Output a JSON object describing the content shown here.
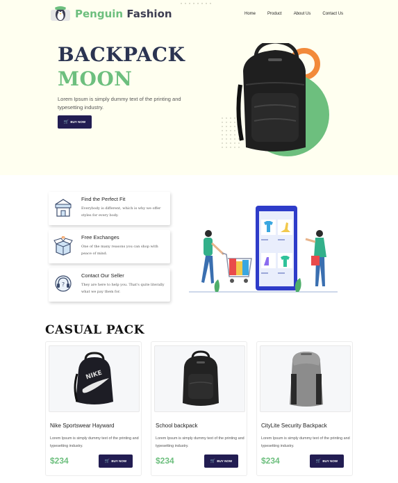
{
  "header": {
    "brand_part1": "Penguin",
    "brand_part2": "Fashion",
    "nav": [
      "Home",
      "Product",
      "About Us",
      "Contact Us"
    ]
  },
  "hero": {
    "title_line1": "BACKPACK",
    "title_line2": "MOON",
    "description": "Lorem Ipsum is simply dummy text of the printing and typesetting industry.",
    "button_label": "BUY NOW"
  },
  "features": [
    {
      "title": "Find the Perfect Fit",
      "text": "Everybody is different, which is why we offer styles for every body.",
      "icon": "storefront-icon"
    },
    {
      "title": "Free Exchanges",
      "text": "One of the many reasons you can shop with peace of mind.",
      "icon": "open-box-icon"
    },
    {
      "title": "Contact Our Seller",
      "text": "They are here to help you. That's quite literally what we pay them for.",
      "icon": "headset-support-icon"
    }
  ],
  "casual": {
    "title": "CASUAL PACK",
    "products": [
      {
        "name": "Nike Sportswear Hayward",
        "desc": "Lorem Ipsum is simply dummy text of the printing and typesetting industry.",
        "price": "$234",
        "button": "BUY NOW"
      },
      {
        "name": "School backpack",
        "desc": "Lorem Ipsum is simply dummy text of the printing and typesetting industry.",
        "price": "$234",
        "button": "BUY NOW"
      },
      {
        "name": "CityLite Security Backpack",
        "desc": "Lorem Ipsum is simply dummy text of the printing and typesetting industry.",
        "price": "$234",
        "button": "BUY NOW"
      }
    ]
  },
  "colors": {
    "accent_green": "#6dbf7e",
    "navy": "#2b3451",
    "button": "#221d52",
    "hero_bg": "#fffff0",
    "orange": "#f28a3a"
  }
}
